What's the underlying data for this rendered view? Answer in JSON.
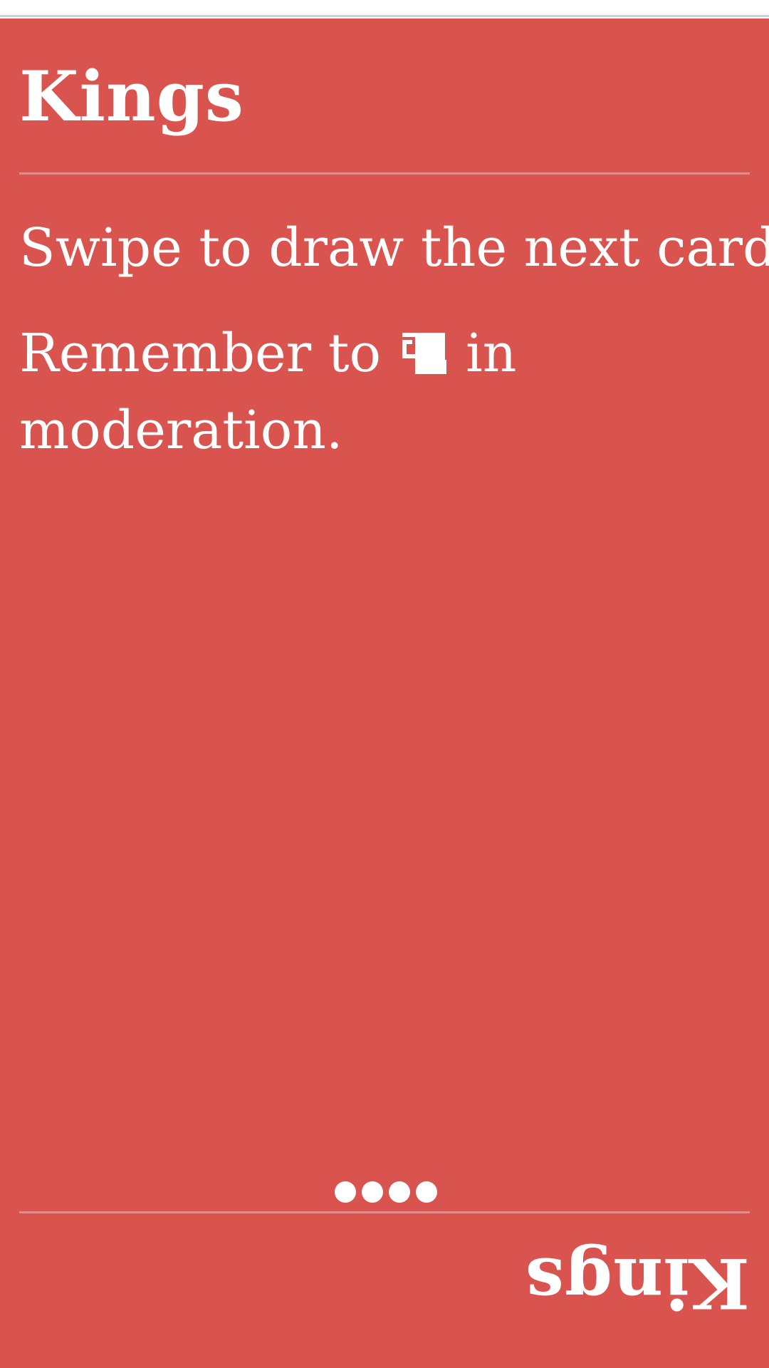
{
  "card": {
    "title": "Kings",
    "instruction": "Swipe to draw the next card.",
    "reminder_before": "Remember to",
    "reminder_icon": "drink-icon",
    "reminder_after": "in moderation.",
    "title_flipped": "Kings",
    "page_dots": 4
  },
  "colors": {
    "card_background": "#d9534f",
    "text": "#ffffff",
    "divider": "#e58b88"
  }
}
